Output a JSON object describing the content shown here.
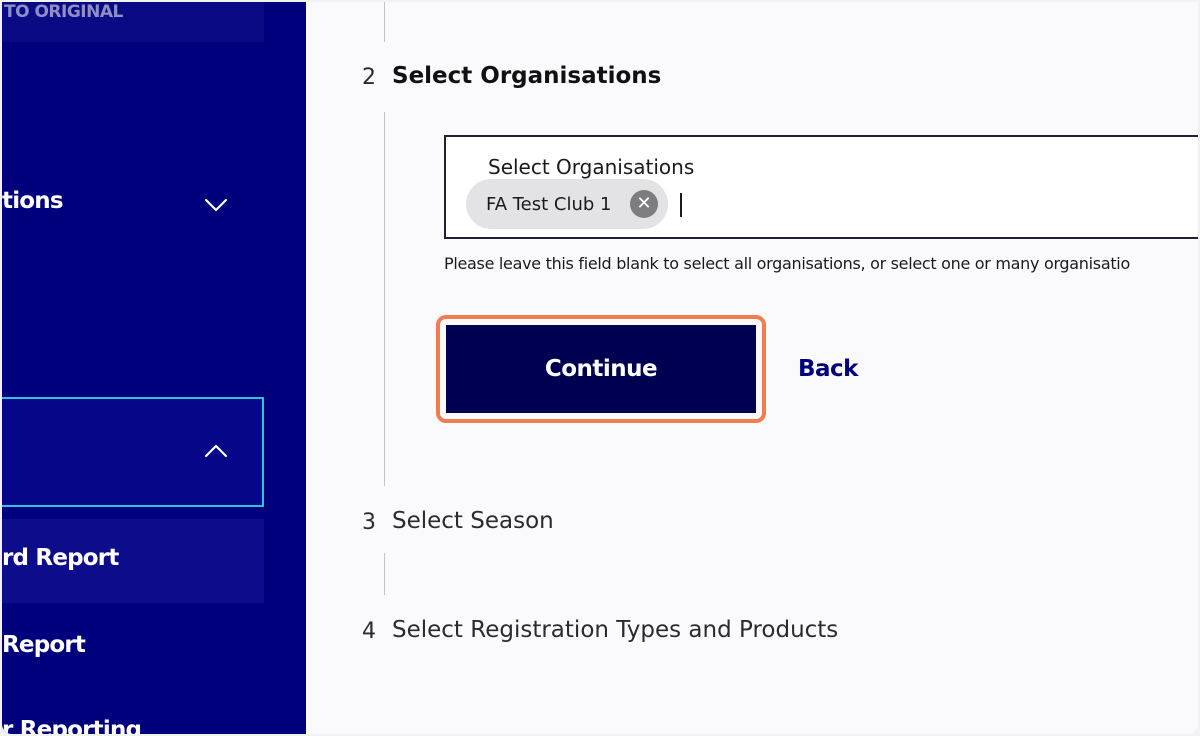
{
  "sidebar": {
    "back_to_original": "TO ORIGINAL",
    "items": [
      {
        "label": "tions",
        "chevron": "chevron-down-icon"
      },
      {
        "label": "",
        "chevron": "chevron-up-icon"
      },
      {
        "label": "rd Report"
      },
      {
        "label": " Report"
      },
      {
        "label": "r Reporting"
      }
    ],
    "colors": {
      "background": "#00007d",
      "selected_border": "#31c3d8"
    }
  },
  "steps": [
    {
      "number": "2",
      "title": "Select Organisations"
    },
    {
      "number": "3",
      "title": "Select Season"
    },
    {
      "number": "4",
      "title": "Select Registration Types and Products"
    }
  ],
  "organisations_field": {
    "label": "Select Organisations",
    "chips": [
      {
        "label": "FA Test Club 1",
        "remove_icon": "close-circle-icon"
      }
    ],
    "help_text": "Please leave this field blank to select all organisations, or select one or many organisatio"
  },
  "actions": {
    "continue_label": "Continue",
    "back_label": "Back",
    "continue_color": "#000052",
    "highlight_color": "#f07d4f"
  }
}
